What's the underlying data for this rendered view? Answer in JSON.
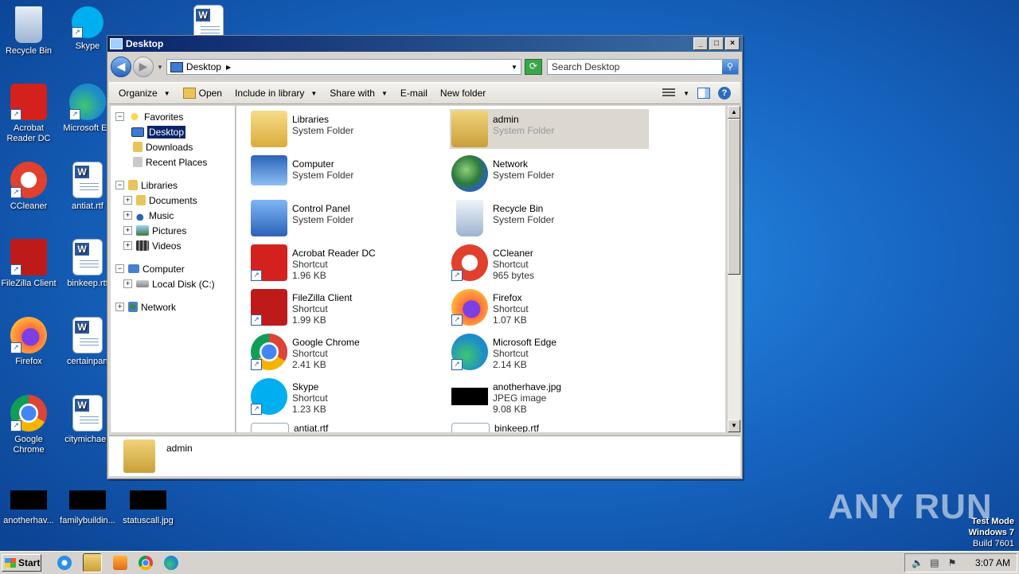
{
  "desktop": {
    "icons": [
      {
        "label": "Recycle Bin",
        "icon": "recycle-bin-icon",
        "color": "#c8d6e8"
      },
      {
        "label": "Skype",
        "icon": "skype-icon",
        "color": "#00aff0"
      },
      {
        "label": "Acrobat Reader DC",
        "icon": "acrobat-icon",
        "color": "#d4211e"
      },
      {
        "label": "Microsoft Ed",
        "icon": "edge-icon",
        "color": "#1e8cc9"
      },
      {
        "label": "CCleaner",
        "icon": "ccleaner-icon",
        "color": "#e0402c"
      },
      {
        "label": "antiat.rtf",
        "icon": "word-doc-icon"
      },
      {
        "label": "FileZilla Client",
        "icon": "filezilla-icon",
        "color": "#bf1a1a"
      },
      {
        "label": "binkeep.rtf",
        "icon": "word-doc-icon"
      },
      {
        "label": "Firefox",
        "icon": "firefox-icon",
        "color": "#ff7139"
      },
      {
        "label": "certainpart",
        "icon": "word-doc-icon"
      },
      {
        "label": "Google Chrome",
        "icon": "chrome-icon",
        "color": "#4285f4"
      },
      {
        "label": "citymichael.",
        "icon": "word-doc-icon"
      },
      {
        "label": "anotherhav...",
        "icon": "jpeg-thumbnail-icon"
      },
      {
        "label": "familybuildin...",
        "icon": "jpeg-thumbnail-icon"
      },
      {
        "label": "statuscall.jpg",
        "icon": "jpeg-thumbnail-icon"
      }
    ]
  },
  "window": {
    "title": "Desktop",
    "address": "Desktop",
    "search_placeholder": "Search Desktop",
    "toolbar": {
      "organize": "Organize",
      "open": "Open",
      "include_in_library": "Include in library",
      "share_with": "Share with",
      "email": "E-mail",
      "new_folder": "New folder"
    },
    "nav": {
      "favorites": "Favorites",
      "desktop": "Desktop",
      "downloads": "Downloads",
      "recent_places": "Recent Places",
      "libraries": "Libraries",
      "documents": "Documents",
      "music": "Music",
      "pictures": "Pictures",
      "videos": "Videos",
      "computer": "Computer",
      "local_disk": "Local Disk (C:)",
      "network": "Network"
    },
    "items": [
      {
        "name": "Libraries",
        "type": "System Folder",
        "size": "",
        "icon": "libraries-icon",
        "color": "#e8c45a"
      },
      {
        "name": "admin",
        "type": "System Folder",
        "size": "",
        "icon": "user-folder-icon",
        "color": "#e0c470",
        "selected": true
      },
      {
        "name": "Computer",
        "type": "System Folder",
        "size": "",
        "icon": "computer-icon",
        "color": "#4a7fc9"
      },
      {
        "name": "Network",
        "type": "System Folder",
        "size": "",
        "icon": "network-icon",
        "color": "#3a8a4a"
      },
      {
        "name": "Control Panel",
        "type": "System Folder",
        "size": "",
        "icon": "control-panel-icon",
        "color": "#4b8ad6"
      },
      {
        "name": "Recycle Bin",
        "type": "System Folder",
        "size": "",
        "icon": "recycle-bin-icon",
        "color": "#c8d6e8"
      },
      {
        "name": "Acrobat Reader DC",
        "type": "Shortcut",
        "size": "1.96 KB",
        "icon": "acrobat-icon",
        "color": "#d4211e"
      },
      {
        "name": "CCleaner",
        "type": "Shortcut",
        "size": "965 bytes",
        "icon": "ccleaner-icon",
        "color": "#e0402c"
      },
      {
        "name": "FileZilla Client",
        "type": "Shortcut",
        "size": "1.99 KB",
        "icon": "filezilla-icon",
        "color": "#bf1a1a"
      },
      {
        "name": "Firefox",
        "type": "Shortcut",
        "size": "1.07 KB",
        "icon": "firefox-icon",
        "color": "#ff7139"
      },
      {
        "name": "Google Chrome",
        "type": "Shortcut",
        "size": "2.41 KB",
        "icon": "chrome-icon",
        "color": "#4285f4"
      },
      {
        "name": "Microsoft Edge",
        "type": "Shortcut",
        "size": "2.14 KB",
        "icon": "edge-icon",
        "color": "#1e8cc9"
      },
      {
        "name": "Skype",
        "type": "Shortcut",
        "size": "1.23 KB",
        "icon": "skype-icon",
        "color": "#00aff0"
      },
      {
        "name": "anotherhave.jpg",
        "type": "JPEG image",
        "size": "9.08 KB",
        "icon": "jpeg-thumbnail-icon",
        "color": "#000000"
      },
      {
        "name": "antiat.rtf",
        "type": "",
        "size": "",
        "icon": "word-doc-icon"
      },
      {
        "name": "binkeep.rtf",
        "type": "",
        "size": "",
        "icon": "word-doc-icon"
      }
    ],
    "details": {
      "name": "admin"
    }
  },
  "taskbar": {
    "start": "Start",
    "clock": "3:07 AM"
  },
  "watermark": "ANY RUN",
  "test_mode": {
    "line1": "Test Mode",
    "line2": "Windows 7",
    "line3": "Build 7601"
  }
}
